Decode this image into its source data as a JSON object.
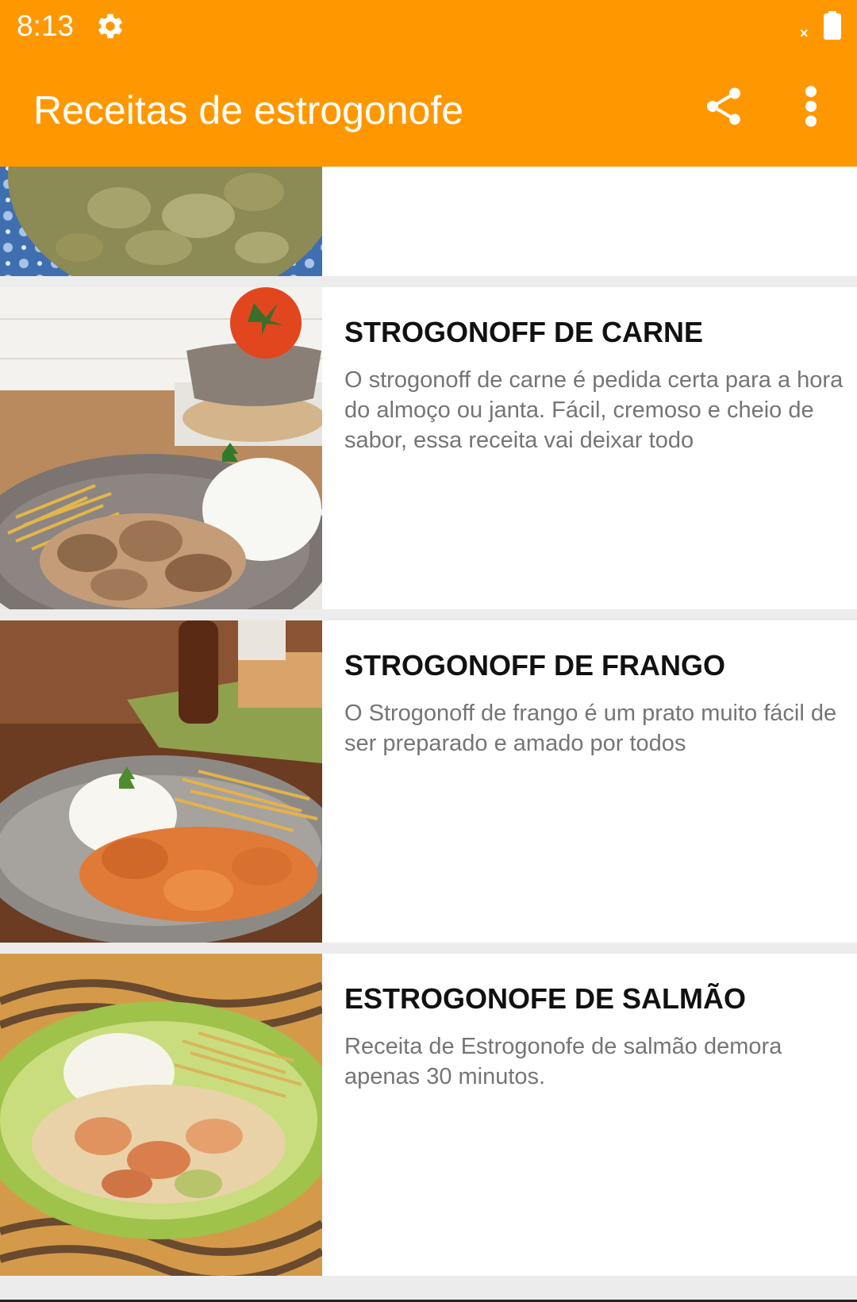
{
  "status_bar": {
    "time": "8:13",
    "icons": [
      "gear-icon",
      "no-signal-icon",
      "battery-icon"
    ],
    "signal_mark": "×"
  },
  "app_bar": {
    "title": "Receitas de estrogonofe",
    "actions": [
      "share-icon",
      "more-vert-icon"
    ]
  },
  "colors": {
    "primary": "#ff9800",
    "card_background": "#ffffff",
    "list_background": "#ececec",
    "title_text": "#111111",
    "description_text": "#757575"
  },
  "recipes": [
    {
      "title": "",
      "description": "",
      "image": "beef stroganoff with mushrooms on blue floral cloth"
    },
    {
      "title": "STROGONOFF DE CARNE",
      "description": "O strogonoff de carne é pedida certa para a hora do almoço ou janta. Fácil, cremoso e cheio de sabor, essa receita vai deixar todo",
      "image": "beef stroganoff plate with rice, potato sticks and tomato"
    },
    {
      "title": "STROGONOFF DE FRANGO",
      "description": "O Strogonoff de frango é um prato muito fácil de ser preparado e amado por todos",
      "image": "chicken stroganoff plate with rice and potato sticks"
    },
    {
      "title": "ESTROGONOFE DE SALMÃO",
      "description": "Receita de Estrogonofe de salmão demora apenas 30 minutos.",
      "image": "salmon stroganoff on green plate with rice and potato sticks"
    }
  ]
}
